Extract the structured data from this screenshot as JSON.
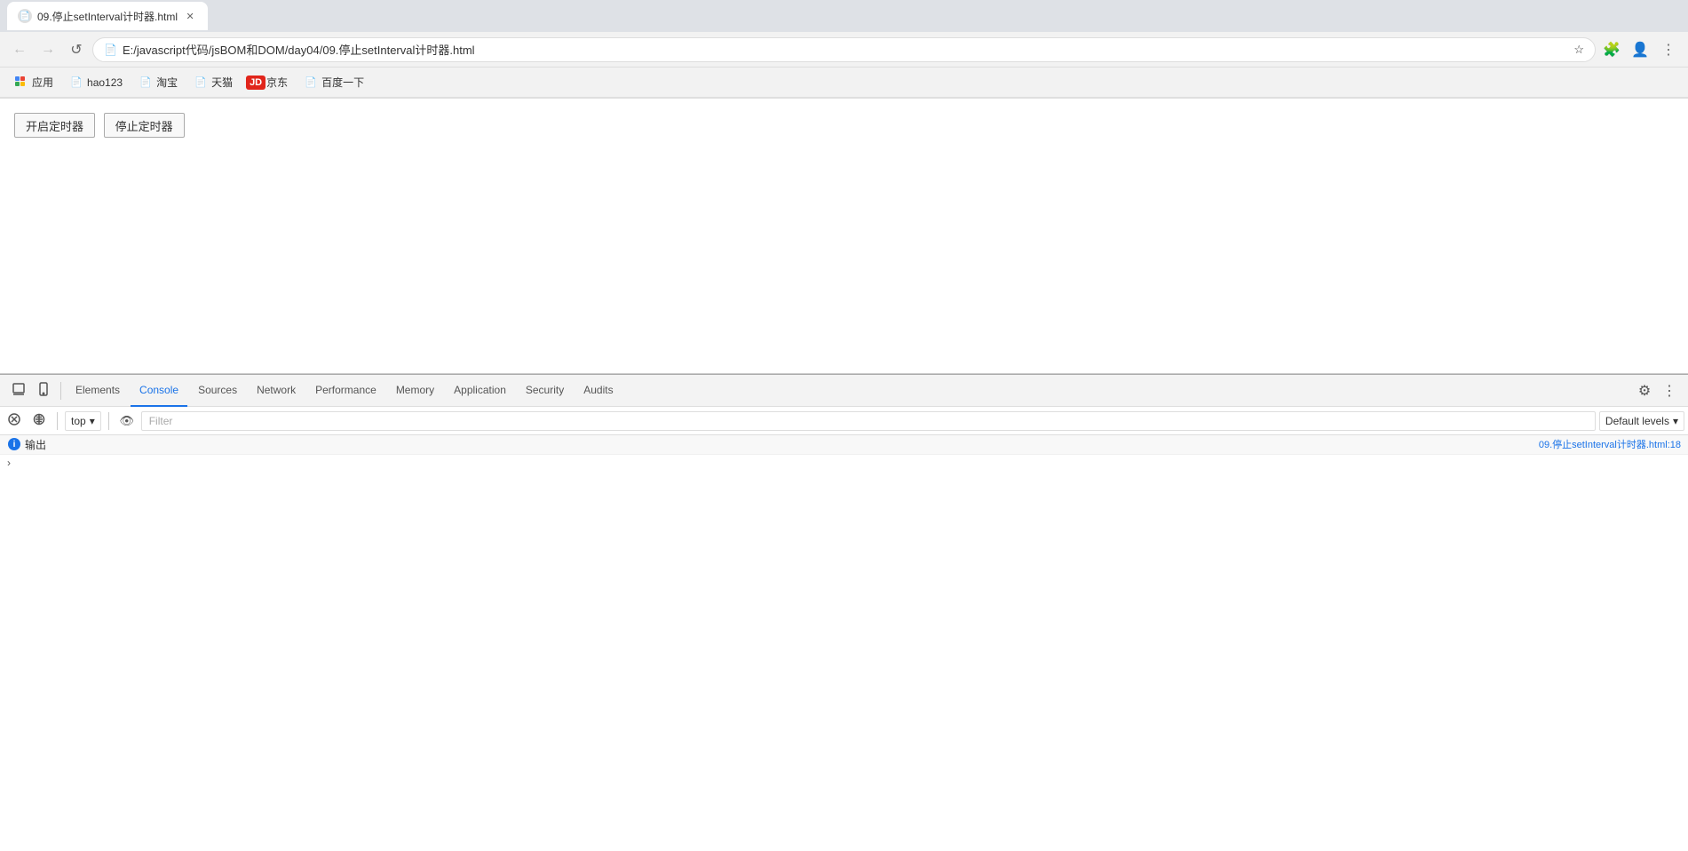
{
  "browser": {
    "tab": {
      "title": "09.停止setInterval计时器.html",
      "favicon": "📄"
    },
    "address": "E:/javascript代码/jsBOM和DOM/day04/09.停止setInterval计时器.html",
    "address_icon": "📄"
  },
  "bookmarks": [
    {
      "id": "apps",
      "label": "应用",
      "icon": "⊞"
    },
    {
      "id": "hao123",
      "label": "hao123",
      "icon": "📄"
    },
    {
      "id": "taobao",
      "label": "淘宝",
      "icon": "📄"
    },
    {
      "id": "tmall",
      "label": "天猫",
      "icon": "📄"
    },
    {
      "id": "jd",
      "label": "京东",
      "icon": "JD"
    },
    {
      "id": "baidu",
      "label": "百度一下",
      "icon": "📄"
    }
  ],
  "page": {
    "btn_start": "开启定时器",
    "btn_stop": "停止定时器"
  },
  "devtools": {
    "tabs": [
      {
        "id": "elements",
        "label": "Elements"
      },
      {
        "id": "console",
        "label": "Console",
        "active": true
      },
      {
        "id": "sources",
        "label": "Sources"
      },
      {
        "id": "network",
        "label": "Network"
      },
      {
        "id": "performance",
        "label": "Performance"
      },
      {
        "id": "memory",
        "label": "Memory"
      },
      {
        "id": "application",
        "label": "Application"
      },
      {
        "id": "security",
        "label": "Security"
      },
      {
        "id": "audits",
        "label": "Audits"
      }
    ],
    "console": {
      "context": "top",
      "filter_placeholder": "Filter",
      "levels": "Default levels",
      "log_text": "输出",
      "log_source": "09.停止setInterval计时器.html:18"
    }
  },
  "icons": {
    "back": "←",
    "forward": "→",
    "reload": "↺",
    "file": "📄",
    "bookmark": "☆",
    "profile": "👤",
    "extensions": "🧩",
    "more": "⋮",
    "grid": "⊞",
    "devtools_inspect": "⬚",
    "devtools_device": "□",
    "devtools_settings": "⚙",
    "devtools_dock": "⊡",
    "devtools_more": "⋮",
    "console_clear": "🚫",
    "console_eye": "👁",
    "info": "i",
    "chevron_down": "▾",
    "prompt": ">"
  }
}
